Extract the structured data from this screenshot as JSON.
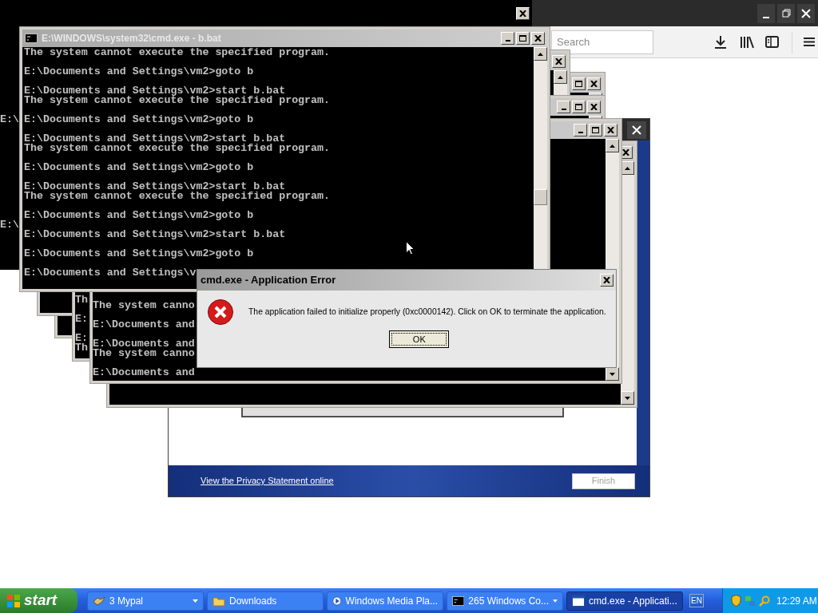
{
  "browser": {
    "search": {
      "placeholder": "Search"
    }
  },
  "installer": {
    "privacy_link": "View the Privacy Statement online",
    "finish_button": {
      "label": "Finish",
      "disabled": true
    }
  },
  "back_console": {
    "fragments": [
      "E:\\",
      "E:\\"
    ]
  },
  "stacked_consoles": [
    {
      "blocks": [
        [
          "Th"
        ],
        [
          "E:"
        ],
        [
          "E:",
          "Th"
        ]
      ]
    },
    {
      "blocks": [
        [
          "The system canno"
        ],
        [
          "E:\\Documents and"
        ],
        [
          "E:\\Documents and",
          "The system canno"
        ],
        [
          "E:\\Documents and"
        ]
      ]
    }
  ],
  "console": {
    "title": "E:\\WINDOWS\\system32\\cmd.exe - b.bat",
    "blocks": [
      [
        "The system cannot execute the specified program."
      ],
      [
        "E:\\Documents and Settings\\vm2>goto b"
      ],
      [
        "E:\\Documents and Settings\\vm2>start b.bat",
        "The system cannot execute the specified program."
      ],
      [
        "E:\\Documents and Settings\\vm2>goto b"
      ],
      [
        "E:\\Documents and Settings\\vm2>start b.bat",
        "The system cannot execute the specified program."
      ],
      [
        "E:\\Documents and Settings\\vm2>goto b"
      ],
      [
        "E:\\Documents and Settings\\vm2>start b.bat",
        "The system cannot execute the specified program."
      ],
      [
        "E:\\Documents and Settings\\vm2>goto b"
      ],
      [
        "E:\\Documents and Settings\\vm2>start b.bat"
      ],
      [
        "E:\\Documents and Settings\\vm2>goto b"
      ],
      [
        "E:\\Documents and Settings\\v"
      ]
    ]
  },
  "error_dialog": {
    "title": "cmd.exe - Application Error",
    "message": "The application failed to initialize properly (0xc0000142). Click on OK to terminate the application.",
    "button": "OK"
  },
  "taskbar": {
    "start": "start",
    "items": [
      {
        "kind": "group",
        "label": "3 Mypal",
        "selected": false
      },
      {
        "kind": "window",
        "label": "Downloads",
        "selected": false
      },
      {
        "kind": "window",
        "label": "Windows Media Pla...",
        "selected": false
      },
      {
        "kind": "group",
        "label": "265 Windows Co...",
        "selected": false
      },
      {
        "kind": "window",
        "label": "cmd.exe - Applicati...",
        "selected": true
      }
    ],
    "language": "EN",
    "clock": "12:29 AM"
  }
}
